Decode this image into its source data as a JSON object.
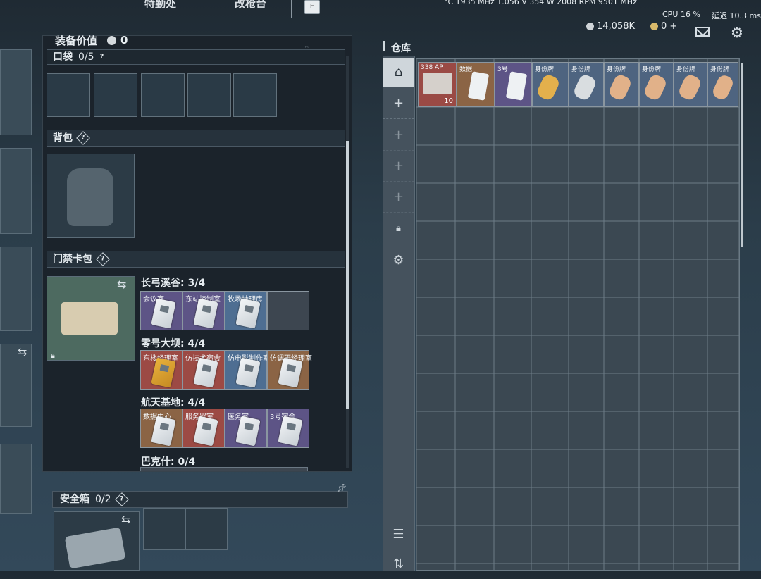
{
  "hud": {
    "stats_line": "°C 1935 MHz 1.056 V 354 W 2008 RPM 9501 MHz",
    "tab_left": "特勤处",
    "tab_right": "改枪台",
    "key_hint": "E",
    "cpu_label": "CPU",
    "cpu_value": "16 %",
    "latency_label": "延迟",
    "latency_value": "10.3 ms",
    "currency_silver": "14,058K",
    "currency_gold": "0 +"
  },
  "equipment": {
    "title": "装备价值",
    "value": "0",
    "pocket": {
      "label": "口袋",
      "count": "0/5"
    },
    "backpack": {
      "label": "背包"
    },
    "keycard_case": {
      "label": "门禁卡包"
    },
    "maps": [
      {
        "name": "长弓溪谷: 3/4",
        "cards": [
          {
            "name": "会议室",
            "color": "purple"
          },
          {
            "name": "东站控制室",
            "color": "purple"
          },
          {
            "name": "牧场地理房",
            "color": "blue"
          },
          {
            "name": "",
            "color": "empty"
          }
        ]
      },
      {
        "name": "零号大坝: 4/4",
        "cards": [
          {
            "name": "东楼经理室",
            "color": "red"
          },
          {
            "name": "仿技术宿舍",
            "color": "red"
          },
          {
            "name": "仿电影制作室",
            "color": "blue"
          },
          {
            "name": "仿调研经理室",
            "color": "brown"
          }
        ]
      },
      {
        "name": "航天基地: 4/4",
        "cards": [
          {
            "name": "数据中心",
            "color": "brown"
          },
          {
            "name": "服务器室",
            "color": "red"
          },
          {
            "name": "医务室",
            "color": "purple"
          },
          {
            "name": "3号宿舍",
            "color": "purple"
          }
        ]
      },
      {
        "name": "巴克什: 0/4",
        "cards": []
      }
    ],
    "safe_box": {
      "label": "安全箱",
      "count": "0/2"
    }
  },
  "warehouse": {
    "title": "仓库",
    "items": [
      {
        "name": "338 AP",
        "count": "10",
        "color": "#9a4a45"
      },
      {
        "name": "数据",
        "color": "#8b6445"
      },
      {
        "name": "3号",
        "color": "#5d5486"
      },
      {
        "name": "身份牌",
        "color": "#4e6480"
      },
      {
        "name": "身份牌",
        "color": "#4e6480"
      },
      {
        "name": "身份牌",
        "color": "#4e6480"
      },
      {
        "name": "身份牌",
        "color": "#4e6480"
      },
      {
        "name": "身份牌",
        "color": "#4e6480"
      },
      {
        "name": "身份牌",
        "color": "#4e6480"
      }
    ]
  }
}
